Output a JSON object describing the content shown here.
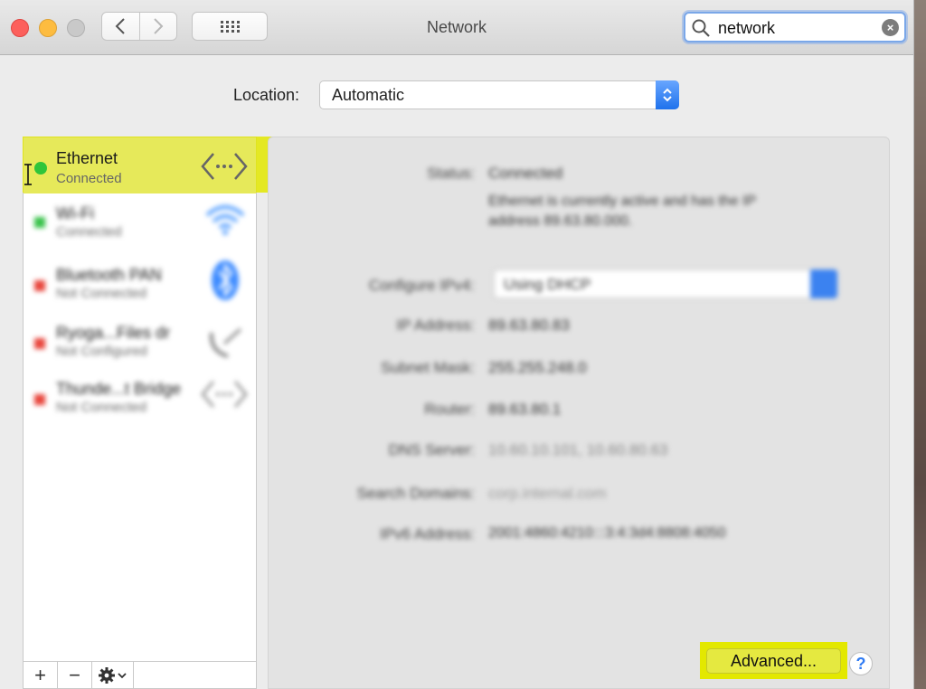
{
  "window": {
    "title": "Network"
  },
  "toolbar": {
    "back_icon": "chevron-left-icon",
    "forward_icon": "chevron-right-icon",
    "grid_icon": "grid-icon"
  },
  "search": {
    "value": "network",
    "clear_glyph": "×"
  },
  "location": {
    "label": "Location:",
    "value": "Automatic"
  },
  "services": [
    {
      "name": "Ethernet",
      "status": "Connected",
      "dot_color": "#2fc53a",
      "icon": "ethernet-arrows-icon",
      "selected": true
    },
    {
      "name": "Wi-Fi",
      "status": "Connected",
      "dot_color": "#38c24a",
      "icon": "wifi-icon",
      "blurred": true
    },
    {
      "name": "Bluetooth PAN",
      "status": "Not Connected",
      "dot_color": "#e8453c",
      "icon": "bluetooth-icon",
      "blurred": true
    },
    {
      "name": "Ryoga...Files dr",
      "status": "Not Configured",
      "dot_color": "#e8453c",
      "icon": "phone-icon",
      "blurred": true
    },
    {
      "name": "Thunde...t Bridge",
      "status": "Not Connected",
      "dot_color": "#e8453c",
      "icon": "ethernet-arrows-icon",
      "blurred": true
    }
  ],
  "sidebar_toolbar": {
    "add": "+",
    "remove": "−"
  },
  "detail": {
    "status_label": "Status:",
    "status_value": "Connected",
    "status_desc_1": "Ethernet is currently active and has the IP",
    "status_desc_2": "address 89.63.80.000.",
    "configure_label": "Configure IPv4:",
    "configure_value": "Using DHCP",
    "ip_label": "IP Address:",
    "ip_value": "89.63.80.83",
    "subnet_label": "Subnet Mask:",
    "subnet_value": "255.255.248.0",
    "router_label": "Router:",
    "router_value": "89.63.80.1",
    "dns_label": "DNS Server:",
    "dns_value": "10.60.10.101, 10.60.80.63",
    "search_domains_label": "Search Domains:",
    "search_domains_value": "corp.internal.com",
    "ipv6_label": "IPv6 Address:",
    "ipv6_value": "2001:4860:4210:::3:4:3d4:8808:4050"
  },
  "buttons": {
    "advanced": "Advanced...",
    "help": "?"
  },
  "colors": {
    "highlight": "#e3e800",
    "accent_blue": "#1f72ec"
  }
}
